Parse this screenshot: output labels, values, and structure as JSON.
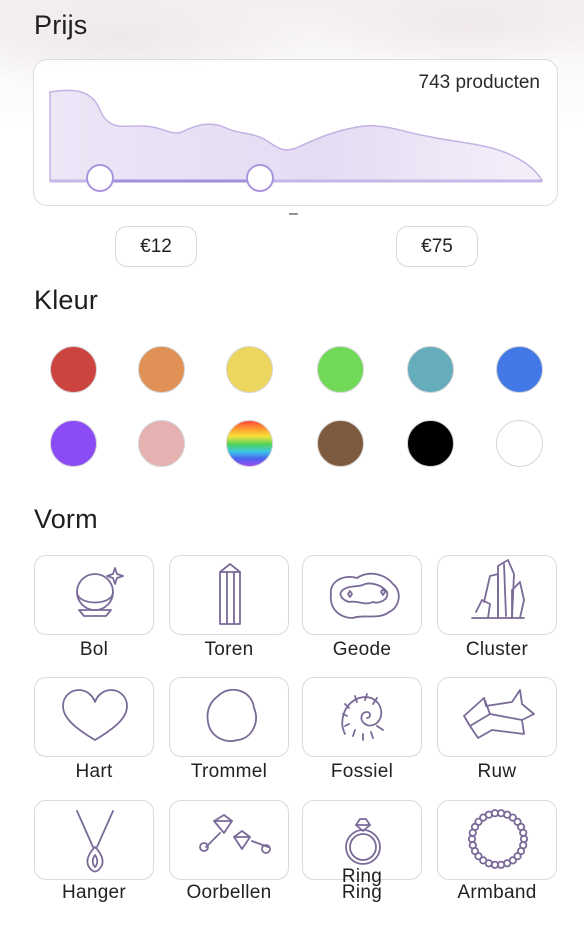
{
  "price": {
    "title": "Prijs",
    "product_count": "743 producten",
    "separator": "–",
    "min_label": "€12",
    "max_label": "€75"
  },
  "color": {
    "title": "Kleur",
    "swatches": [
      {
        "name": "rood",
        "hex": "#cc4440"
      },
      {
        "name": "oranje",
        "hex": "#e09155"
      },
      {
        "name": "geel",
        "hex": "#ecd660"
      },
      {
        "name": "groen",
        "hex": "#70d957"
      },
      {
        "name": "turquoise",
        "hex": "#66adbb"
      },
      {
        "name": "blauw",
        "hex": "#4279e6"
      },
      {
        "name": "paars",
        "hex": "#8b4cf5"
      },
      {
        "name": "roze",
        "hex": "#e5b2b1"
      },
      {
        "name": "regenboog",
        "hex": "rainbow"
      },
      {
        "name": "bruin",
        "hex": "#7e5b3f"
      },
      {
        "name": "zwart",
        "hex": "#000000"
      },
      {
        "name": "wit",
        "hex": "#ffffff"
      }
    ]
  },
  "shape": {
    "title": "Vorm",
    "items": [
      {
        "label": "Bol",
        "icon": "sphere-icon"
      },
      {
        "label": "Toren",
        "icon": "tower-icon"
      },
      {
        "label": "Geode",
        "icon": "geode-icon"
      },
      {
        "label": "Cluster",
        "icon": "cluster-icon"
      },
      {
        "label": "Hart",
        "icon": "heart-icon"
      },
      {
        "label": "Trommel",
        "icon": "tumble-icon"
      },
      {
        "label": "Fossiel",
        "icon": "fossil-icon"
      },
      {
        "label": "Ruw",
        "icon": "rough-icon"
      },
      {
        "label": "Hanger",
        "icon": "pendant-icon"
      },
      {
        "label": "Oorbellen",
        "icon": "earrings-icon"
      },
      {
        "label": "Ring",
        "icon": "ring-icon",
        "overlay_label": "Ring"
      },
      {
        "label": "Armband",
        "icon": "bracelet-icon"
      }
    ]
  },
  "colors": {
    "accent": "#9b86d6",
    "accent_fill": "#ece6f7",
    "icon_stroke": "#7a6a98"
  }
}
